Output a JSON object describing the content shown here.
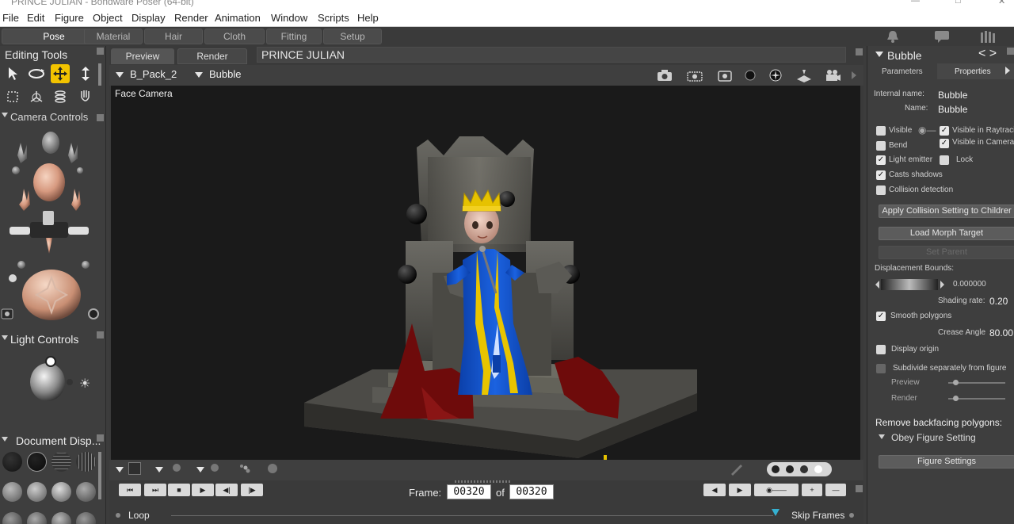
{
  "app": {
    "window_title": "PRINCE JULIAN - Bondware Poser (64-bit)"
  },
  "menu": [
    "File",
    "Edit",
    "Figure",
    "Object",
    "Display",
    "Render",
    "Animation",
    "Window",
    "Scripts",
    "Help"
  ],
  "rooms": [
    {
      "label": "Pose",
      "active": true
    },
    {
      "label": "Material",
      "active": false
    },
    {
      "label": "Hair",
      "active": false
    },
    {
      "label": "Cloth",
      "active": false
    },
    {
      "label": "Fitting",
      "active": false
    },
    {
      "label": "Setup",
      "active": false
    }
  ],
  "left_panel": {
    "editing_tools_title": "Editing Tools",
    "camera_controls_title": "Camera Controls",
    "light_controls_title": "Light Controls",
    "document_display_title": "Document  Disp..."
  },
  "document": {
    "tabs": [
      {
        "label": "Preview",
        "active": true
      },
      {
        "label": "Render",
        "active": false
      }
    ],
    "title": "PRINCE JULIAN",
    "figure_selector": "B_Pack_2",
    "actor_selector": "Bubble",
    "camera_label": "Face Camera"
  },
  "animation": {
    "frame_label": "Frame:",
    "of_label": "of",
    "current_frame": "00320",
    "total_frames": "00320",
    "loop_label": "Loop",
    "skip_frames_label": "Skip Frames"
  },
  "properties": {
    "header": "Bubble",
    "tabs": [
      "Parameters",
      "Properties"
    ],
    "internal_name_label": "Internal name:",
    "internal_name": "Bubble",
    "name_label": "Name:",
    "name": "Bubble",
    "checkboxes": {
      "visible": {
        "label": "Visible",
        "checked": false
      },
      "visible_in_raytracing": {
        "label": "Visible in Raytraci",
        "checked": true
      },
      "bend": {
        "label": "Bend",
        "checked": false
      },
      "visible_in_camera": {
        "label": "Visible in Camera",
        "checked": true
      },
      "light_emitter": {
        "label": "Light emitter",
        "checked": true
      },
      "lock": {
        "label": "Lock",
        "checked": false
      },
      "casts_shadows": {
        "label": "Casts shadows",
        "checked": true
      },
      "collision_detection": {
        "label": "Collision detection",
        "checked": false
      },
      "smooth_polygons": {
        "label": "Smooth polygons",
        "checked": true
      },
      "display_origin": {
        "label": "Display origin",
        "checked": false
      },
      "subdivide_separately": {
        "label": "Subdivide separately from figure",
        "checked": false
      }
    },
    "apply_collision_button": "Apply Collision Setting to Childrer",
    "load_morph_button": "Load Morph Target",
    "set_parent_button": "Set Parent",
    "displacement_bounds_label": "Displacement Bounds:",
    "displacement_value": "0.000000",
    "shading_rate_label": "Shading rate:",
    "shading_rate": "0.20",
    "crease_angle_label": "Crease Angle",
    "crease_angle": "80.00",
    "preview_label": "Preview",
    "render_label": "Render",
    "remove_backfacing_label": "Remove backfacing polygons:",
    "obey_figure_setting": "Obey Figure Setting",
    "figure_settings_button": "Figure Settings"
  }
}
